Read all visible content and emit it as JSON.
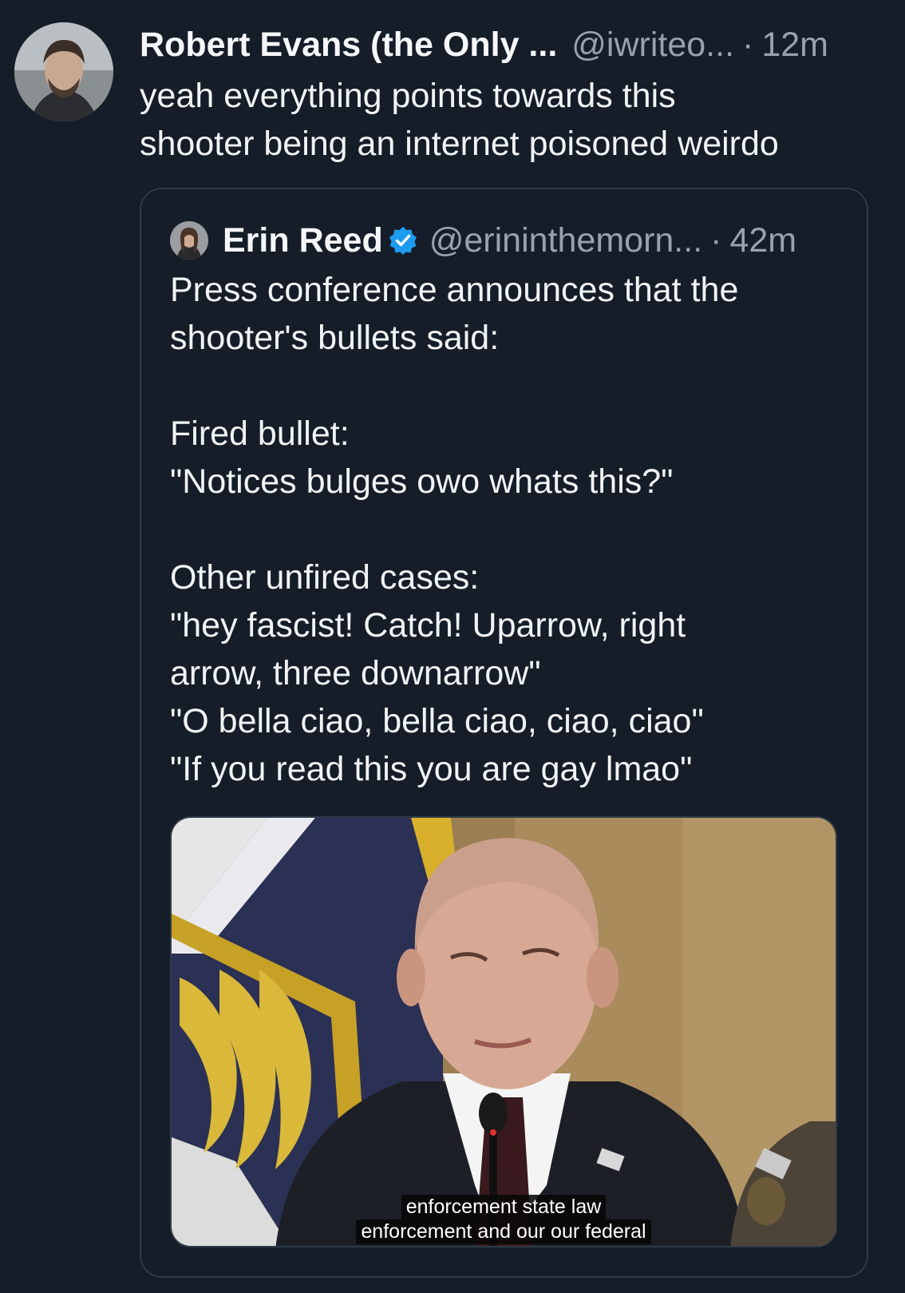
{
  "post": {
    "author_name": "Robert Evans (the Only ...",
    "handle": "@iwriteo...",
    "separator": "·",
    "time": "12m",
    "text_lines": [
      "yeah everything points towards this",
      "shooter being an internet poisoned weirdo"
    ]
  },
  "quote": {
    "author_name": "Erin Reed",
    "verified_icon": "verified-badge-icon",
    "handle": "@erininthemorn...",
    "separator": "·",
    "time": "42m",
    "text_lines": [
      "Press conference announces that the",
      "shooter's bullets said:",
      "",
      "Fired bullet:",
      "\"Notices bulges owo whats this?\"",
      "",
      "Other unfired cases:",
      "\"hey fascist! Catch! Uparrow, right",
      "arrow, three downarrow\"",
      "\"O bella ciao, bella ciao, ciao, ciao\"",
      "\"If you read this you are gay lmao\""
    ],
    "media": {
      "captions": [
        "enforcement state law",
        "enforcement and our our federal"
      ]
    }
  },
  "colors": {
    "background": "#151d28",
    "text": "#f1f3f5",
    "muted": "#98a2ad",
    "border": "#2f3b48",
    "verified": "#1d9bf0"
  }
}
